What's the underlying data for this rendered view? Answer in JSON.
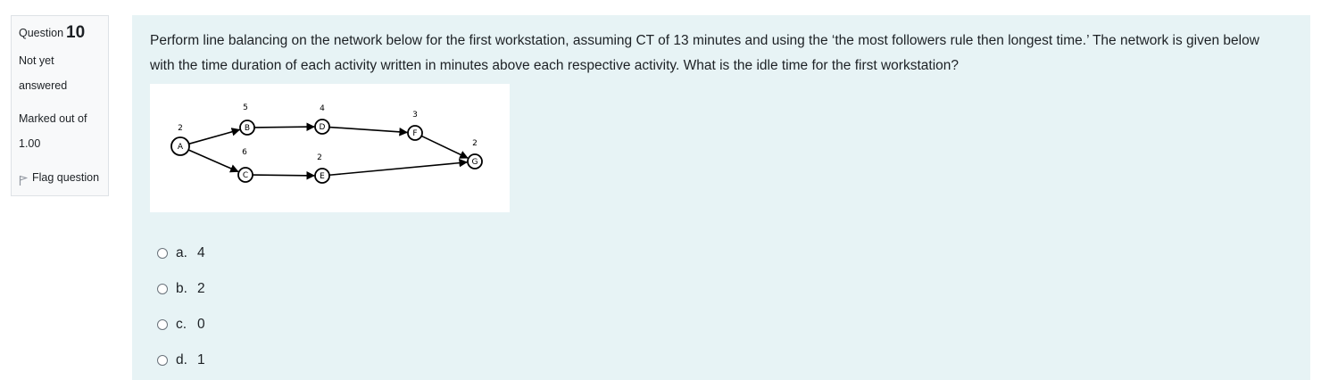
{
  "info": {
    "question_label": "Question",
    "question_number": "10",
    "state_line1": "Not yet",
    "state_line2": "answered",
    "grade_line1": "Marked out of",
    "grade_line2": "1.00",
    "flag_label": "Flag question",
    "flag_icon": "flag-icon"
  },
  "question": {
    "text": "Perform line balancing on the network below for the first workstation, assuming CT of 13 minutes and using the ‘the most followers rule then longest time.’  The network is given below with the time duration of each activity written in minutes above each respective activity. What is the idle time for the first workstation?"
  },
  "network": {
    "nodes": [
      {
        "id": "A",
        "time": "2"
      },
      {
        "id": "B",
        "time": "5"
      },
      {
        "id": "C",
        "time": "6"
      },
      {
        "id": "D",
        "time": "4"
      },
      {
        "id": "E",
        "time": "2"
      },
      {
        "id": "F",
        "time": "3"
      },
      {
        "id": "G",
        "time": "2"
      }
    ],
    "edges": [
      [
        "A",
        "B"
      ],
      [
        "A",
        "C"
      ],
      [
        "B",
        "D"
      ],
      [
        "D",
        "F"
      ],
      [
        "F",
        "G"
      ],
      [
        "C",
        "E"
      ],
      [
        "E",
        "G"
      ]
    ]
  },
  "answers": [
    {
      "letter": "a.",
      "value": "4"
    },
    {
      "letter": "b.",
      "value": "2"
    },
    {
      "letter": "c.",
      "value": "0"
    },
    {
      "letter": "d.",
      "value": "1"
    }
  ]
}
